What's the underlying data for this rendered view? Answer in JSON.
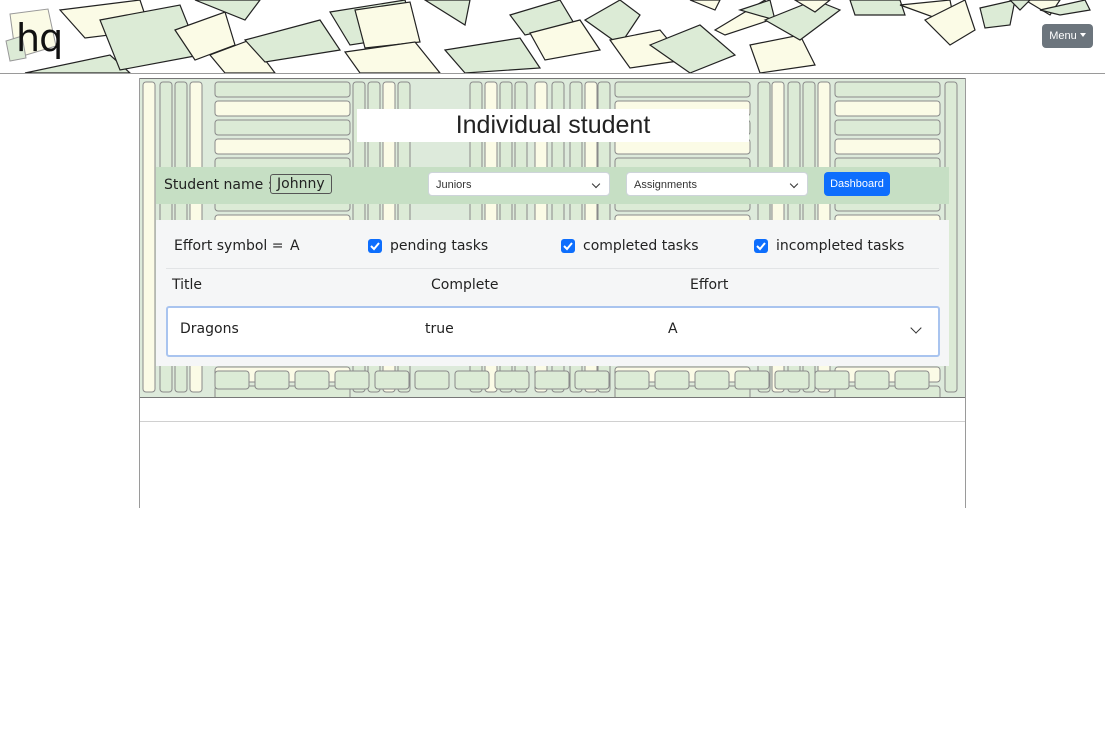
{
  "header": {
    "logo_text": "hq",
    "menu_label": "Menu"
  },
  "page": {
    "title": "Individual student"
  },
  "controls": {
    "student_label": "Student name :",
    "student_name": "Johnny",
    "group_select": "Juniors",
    "view_select": "Assignments",
    "dashboard_label": "Dashboard"
  },
  "filters": {
    "effort_label": "Effort symbol =",
    "effort_symbol": "A",
    "pending_label": "pending tasks",
    "pending_checked": true,
    "completed_label": "completed tasks",
    "completed_checked": true,
    "incompleted_label": "incompleted tasks",
    "incompleted_checked": true
  },
  "table": {
    "columns": [
      "Title",
      "Complete",
      "Effort"
    ],
    "rows": [
      {
        "title": "Dragons",
        "complete": "true",
        "effort": "A"
      }
    ]
  },
  "colors": {
    "accent": "#0d6efd",
    "menu_button": "#6c757d",
    "control_bar": "#c6dfc4",
    "paper_fill": "#dcebd6",
    "paper_fill_alt": "#fbfbe6"
  }
}
